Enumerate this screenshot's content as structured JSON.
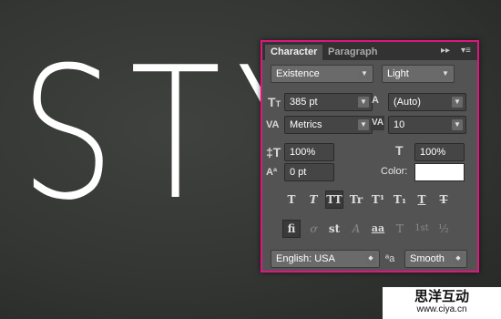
{
  "canvas": {
    "text": "STYL"
  },
  "panel": {
    "tabs": [
      {
        "label": "Character"
      },
      {
        "label": "Paragraph"
      }
    ],
    "controls": {
      "expand": "▸▸",
      "menu": "▾≡"
    },
    "font_family": "Existence",
    "font_style": "Light",
    "font_size": "385 pt",
    "leading": "(Auto)",
    "kerning": "Metrics",
    "tracking": "10",
    "vertical_scale": "100%",
    "horizontal_scale": "100%",
    "baseline_shift": "0 pt",
    "color_label": "Color:",
    "color_value": "#ffffff",
    "type_buttons": [
      "T",
      "T",
      "TT",
      "Tr",
      "T¹",
      "T₁",
      "T",
      "T"
    ],
    "opentype_buttons": [
      "fi",
      "ơ",
      "st",
      "A",
      "aa",
      "T",
      "1st",
      "½"
    ],
    "language": "English: USA",
    "aa_glyph": "ªa",
    "antialias": "Smooth"
  },
  "watermark": {
    "title": "思洋互动",
    "url": "www.ciya.cn"
  }
}
